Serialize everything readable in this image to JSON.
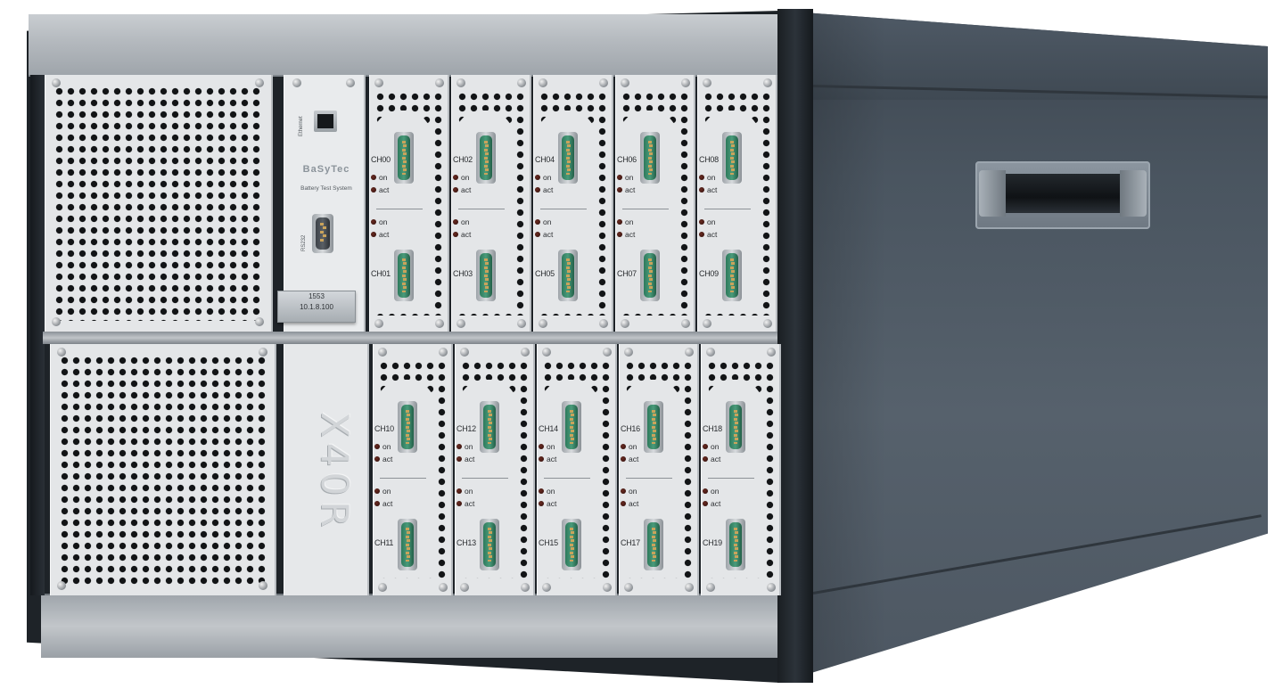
{
  "scene": {
    "title": "",
    "controller": {
      "ethernet_label": "Ethernet",
      "brand": "BaSyTec",
      "subtitle": "Battery Test System",
      "serial_label": "RS232",
      "tag_line1": "1553",
      "tag_line2": "10.1.8.100"
    },
    "chassis_label": "X40R",
    "led_on": "on",
    "led_act": "act",
    "channels_top": [
      "CH00",
      "CH01",
      "CH02",
      "CH03",
      "CH04",
      "CH05",
      "CH06",
      "CH07",
      "CH08",
      "CH09"
    ],
    "channels_bottom": [
      "CH10",
      "CH11",
      "CH12",
      "CH13",
      "CH14",
      "CH15",
      "CH16",
      "CH17",
      "CH18",
      "CH19"
    ]
  },
  "colors": {
    "chassis_side": "#4a5560",
    "panel": "#e4e6e8",
    "connector": "#2d7a5c",
    "led": "#6b2b22"
  }
}
